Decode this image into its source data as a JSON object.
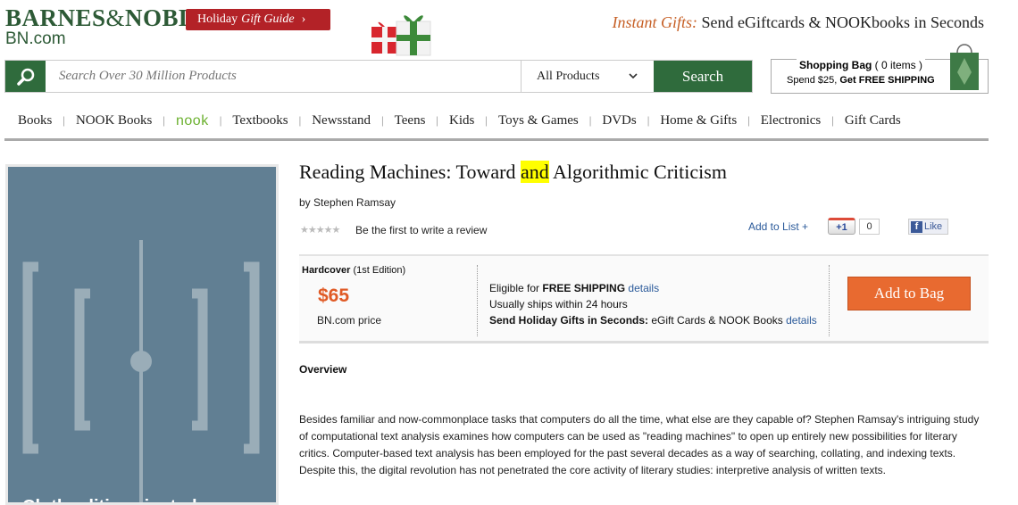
{
  "header": {
    "logo_main_left": "BARNES",
    "logo_amp": "&",
    "logo_main_right": "NOBLE",
    "logo_sub": "BN.com",
    "holiday_a": "Holiday",
    "holiday_b": "Gift Guide",
    "holiday_chevron": "›",
    "instant_label": "Instant Gifts:",
    "instant_text": "Send eGiftcards & NOOKbooks in Seconds"
  },
  "search": {
    "placeholder": "Search Over 30 Million Products",
    "category": "All Products",
    "button": "Search"
  },
  "bag": {
    "title": "Shopping Bag",
    "count": "( 0 items )",
    "spend": "Spend $25,",
    "free": "Get FREE SHIPPING"
  },
  "nav": {
    "items": [
      "Books",
      "NOOK Books",
      "nook",
      "Textbooks",
      "Newsstand",
      "Teens",
      "Kids",
      "Toys & Games",
      "DVDs",
      "Home & Gifts",
      "Electronics",
      "Gift Cards"
    ],
    "sep": "|"
  },
  "cover": {
    "text": "Ch the ditie ...  ianted"
  },
  "product": {
    "title_a": "Reading Machines: Toward ",
    "title_hl": "and",
    "title_b": " Algorithmic Criticism",
    "author": "by Stephen Ramsay",
    "stars": "★★★★★",
    "review": "Be the first to write a review",
    "add_list": "Add to List +",
    "gplus": "+1",
    "gplus_count": "0",
    "fb_f": "f",
    "fb_like": "Like"
  },
  "purchase": {
    "format": "Hardcover",
    "edition": "(1st Edition)",
    "price": "$65",
    "price_label": "BN.com price",
    "ship1_a": "Eligible for ",
    "ship1_b": "FREE SHIPPING",
    "ship1_link": "details",
    "ship2": "Usually ships within 24 hours",
    "ship3_a": "Send Holiday Gifts in Seconds:",
    "ship3_b": " eGift Cards & NOOK Books ",
    "ship3_link": "details",
    "add_to_bag": "Add to Bag"
  },
  "overview": {
    "heading": "Overview",
    "body": "Besides familiar and now-commonplace tasks that computers do all the time, what else are they capable of? Stephen Ramsay's intriguing study of computational text analysis examines how computers can be used as \"reading machines\" to open up entirely new possibilities for literary critics. Computer-based text analysis has been employed for the past several decades as a way of searching, collating, and indexing texts. Despite this, the digital revolution has not penetrated the core activity of literary studies: interpretive analysis of written texts."
  },
  "colors": {
    "brand_green": "#2d5a36",
    "holiday_red": "#b32227",
    "price_orange": "#e05a25",
    "cover_blue": "#617f93"
  }
}
